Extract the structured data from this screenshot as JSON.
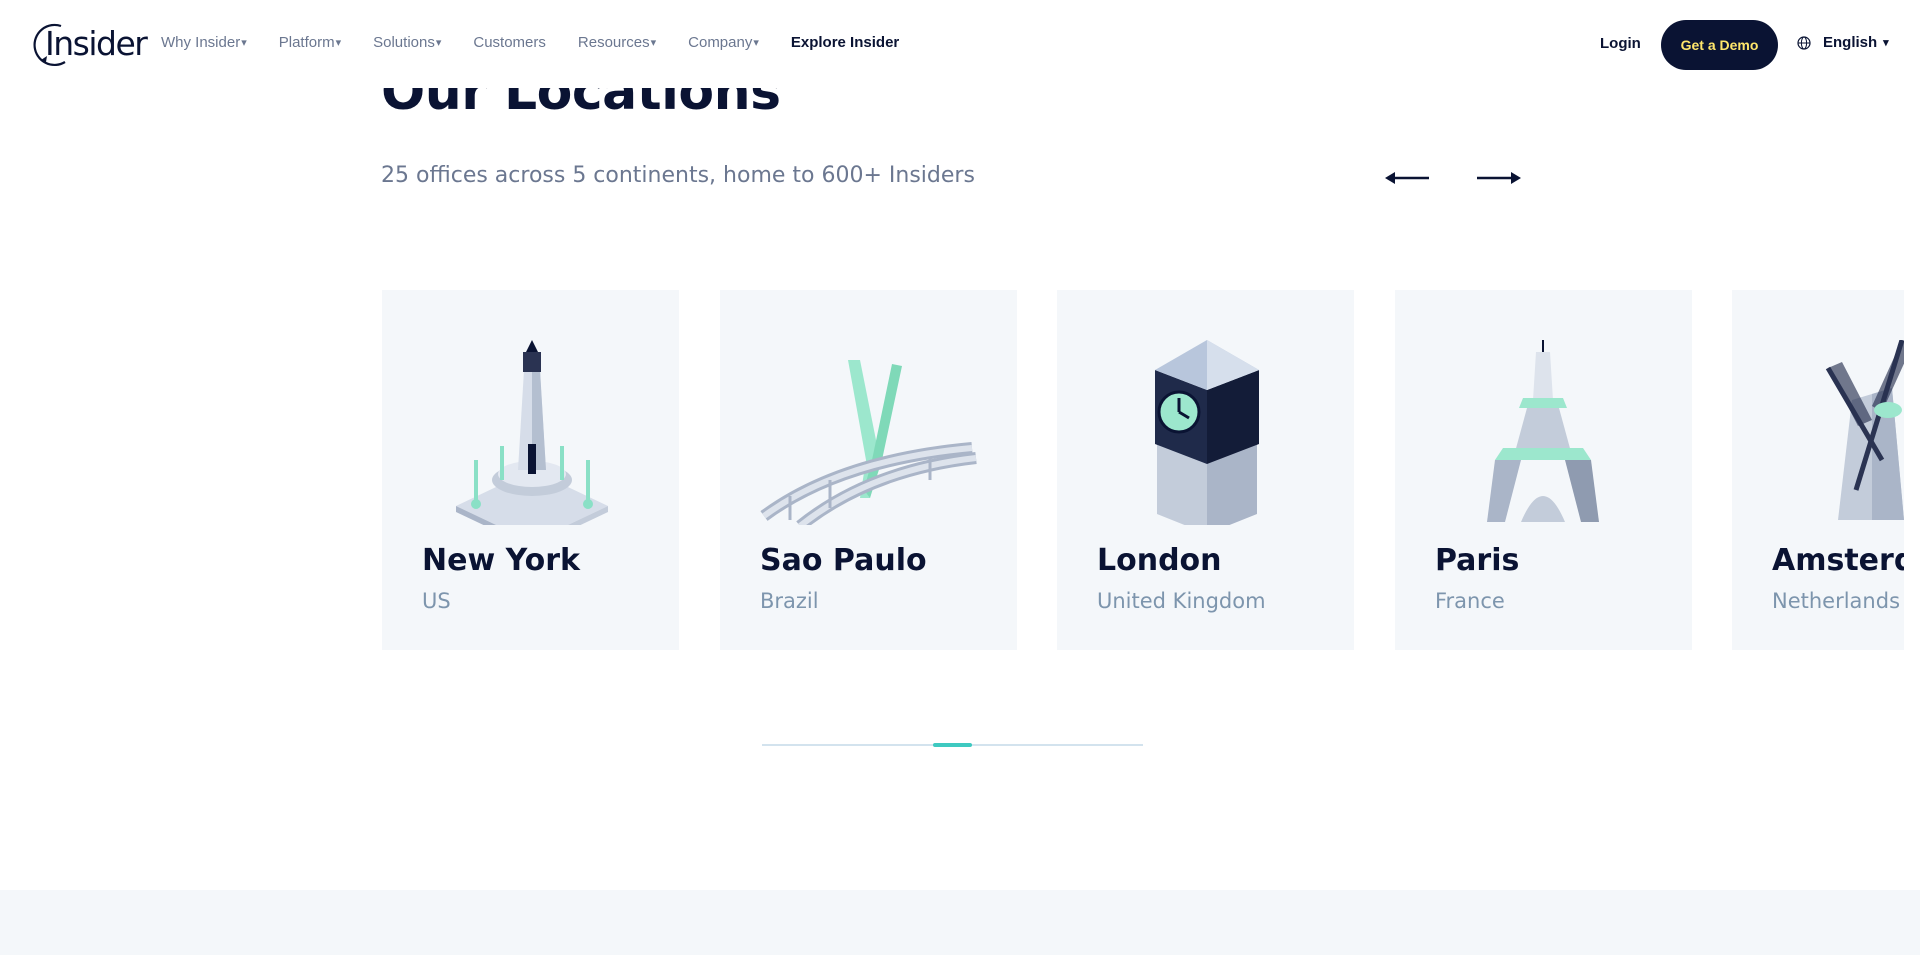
{
  "header": {
    "logo_text": "Insider",
    "nav": [
      {
        "label": "Why Insider",
        "caret": "▾"
      },
      {
        "label": "Platform",
        "caret": "▾"
      },
      {
        "label": "Solutions",
        "caret": "▾"
      },
      {
        "label": "Customers",
        "caret": ""
      },
      {
        "label": "Resources",
        "caret": "▾"
      },
      {
        "label": "Company",
        "caret": "▾"
      },
      {
        "label": "Explore Insider",
        "caret": ""
      }
    ],
    "login_label": "Login",
    "demo_label": "Get a Demo",
    "language_label": "English",
    "language_caret": "▾",
    "icons": {
      "globe": "globe-icon",
      "prev": "arrow-left-icon",
      "next": "arrow-right-icon"
    }
  },
  "section": {
    "title": "Our Locations",
    "subtitle": "25 offices across 5 continents, home to 600+ Insiders"
  },
  "locations": [
    {
      "city": "New York",
      "country": "US",
      "icon": "lighthouse-monument-icon"
    },
    {
      "city": "Sao Paulo",
      "country": "Brazil",
      "icon": "cable-bridge-icon"
    },
    {
      "city": "London",
      "country": "United Kingdom",
      "icon": "clock-tower-icon"
    },
    {
      "city": "Paris",
      "country": "France",
      "icon": "eiffel-tower-icon"
    },
    {
      "city": "Amsterdam",
      "country": "Netherlands",
      "icon": "windmill-icon"
    }
  ],
  "carousel": {
    "progress_start": 0.45,
    "progress_end": 0.55
  },
  "colors": {
    "navy": "#0a1333",
    "accent_yellow": "#ffe66b",
    "mint": "#3ec9c0",
    "muted_text": "#6b7790",
    "card_bg": "#f4f7fa"
  }
}
